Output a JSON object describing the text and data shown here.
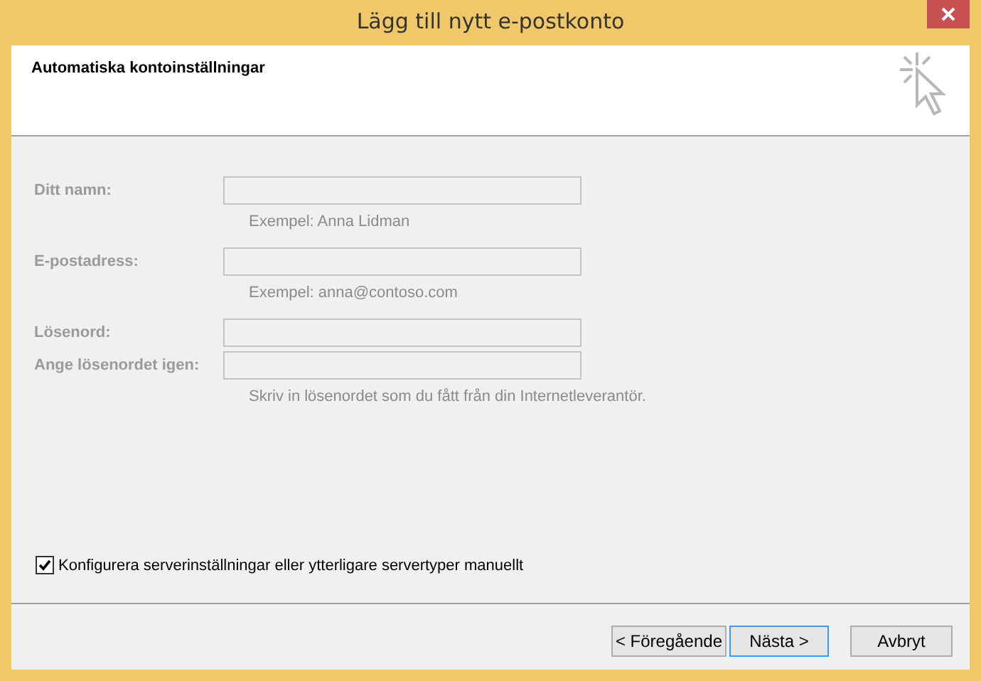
{
  "window": {
    "title": "Lägg till nytt e-postkonto"
  },
  "header": {
    "title": "Automatiska kontoinställningar"
  },
  "fields": [
    {
      "label": "Ditt namn:",
      "hint": "Exempel: Anna Lidman",
      "disabled": true
    },
    {
      "label": "E-postadress:",
      "hint": "Exempel: anna@contoso.com",
      "disabled": true
    },
    {
      "label": "Lösenord:",
      "disabled": true
    },
    {
      "label": "Ange lösenordet igen:",
      "hint": "Skriv in lösenordet som du fått från din Internetleverantör.",
      "disabled": true
    }
  ],
  "manual_config": {
    "label": "Konfigurera serverinställningar eller ytterligare servertyper manuellt",
    "checked": true
  },
  "buttons": [
    {
      "label": "< Föregående",
      "default": false
    },
    {
      "label": "Nästa >",
      "default": true
    },
    {
      "label": "Avbryt",
      "default": false
    }
  ]
}
